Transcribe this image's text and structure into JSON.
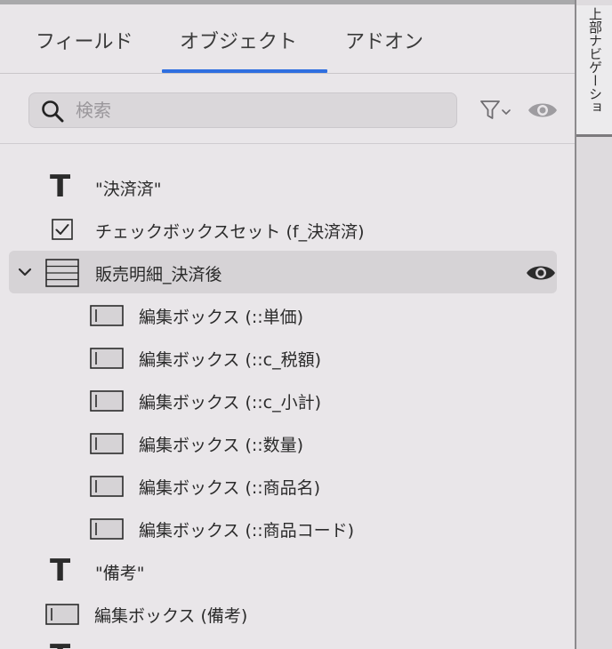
{
  "tabs": [
    {
      "label": "フィールド"
    },
    {
      "label": "オブジェクト"
    },
    {
      "label": "アドオン"
    }
  ],
  "active_tab": "オブジェクト",
  "accent_color": "#2f6fe0",
  "search": {
    "placeholder": "検索",
    "value": ""
  },
  "objects": [
    {
      "icon": "text-icon",
      "label": "\"決済済\""
    },
    {
      "icon": "checkbox-icon",
      "label": "チェックボックスセット (f_決済済)"
    },
    {
      "icon": "portal-icon",
      "label": "販売明細_決済後",
      "expanded": true,
      "selected": true,
      "visible_toggle": "eye-icon"
    },
    {
      "icon": "edit-box-icon",
      "label": "編集ボックス (::単価)"
    },
    {
      "icon": "edit-box-icon",
      "label": "編集ボックス (::c_税額)"
    },
    {
      "icon": "edit-box-icon",
      "label": "編集ボックス (::c_小計)"
    },
    {
      "icon": "edit-box-icon",
      "label": "編集ボックス (::数量)"
    },
    {
      "icon": "edit-box-icon",
      "label": "編集ボックス (::商品名)"
    },
    {
      "icon": "edit-box-icon",
      "label": "編集ボックス (::商品コード)"
    },
    {
      "icon": "text-icon",
      "label": "\"備考\""
    },
    {
      "icon": "edit-box-icon",
      "label": "編集ボックス (備考)"
    }
  ],
  "side_panel": {
    "tab_label": "上部ナビゲーショ"
  }
}
